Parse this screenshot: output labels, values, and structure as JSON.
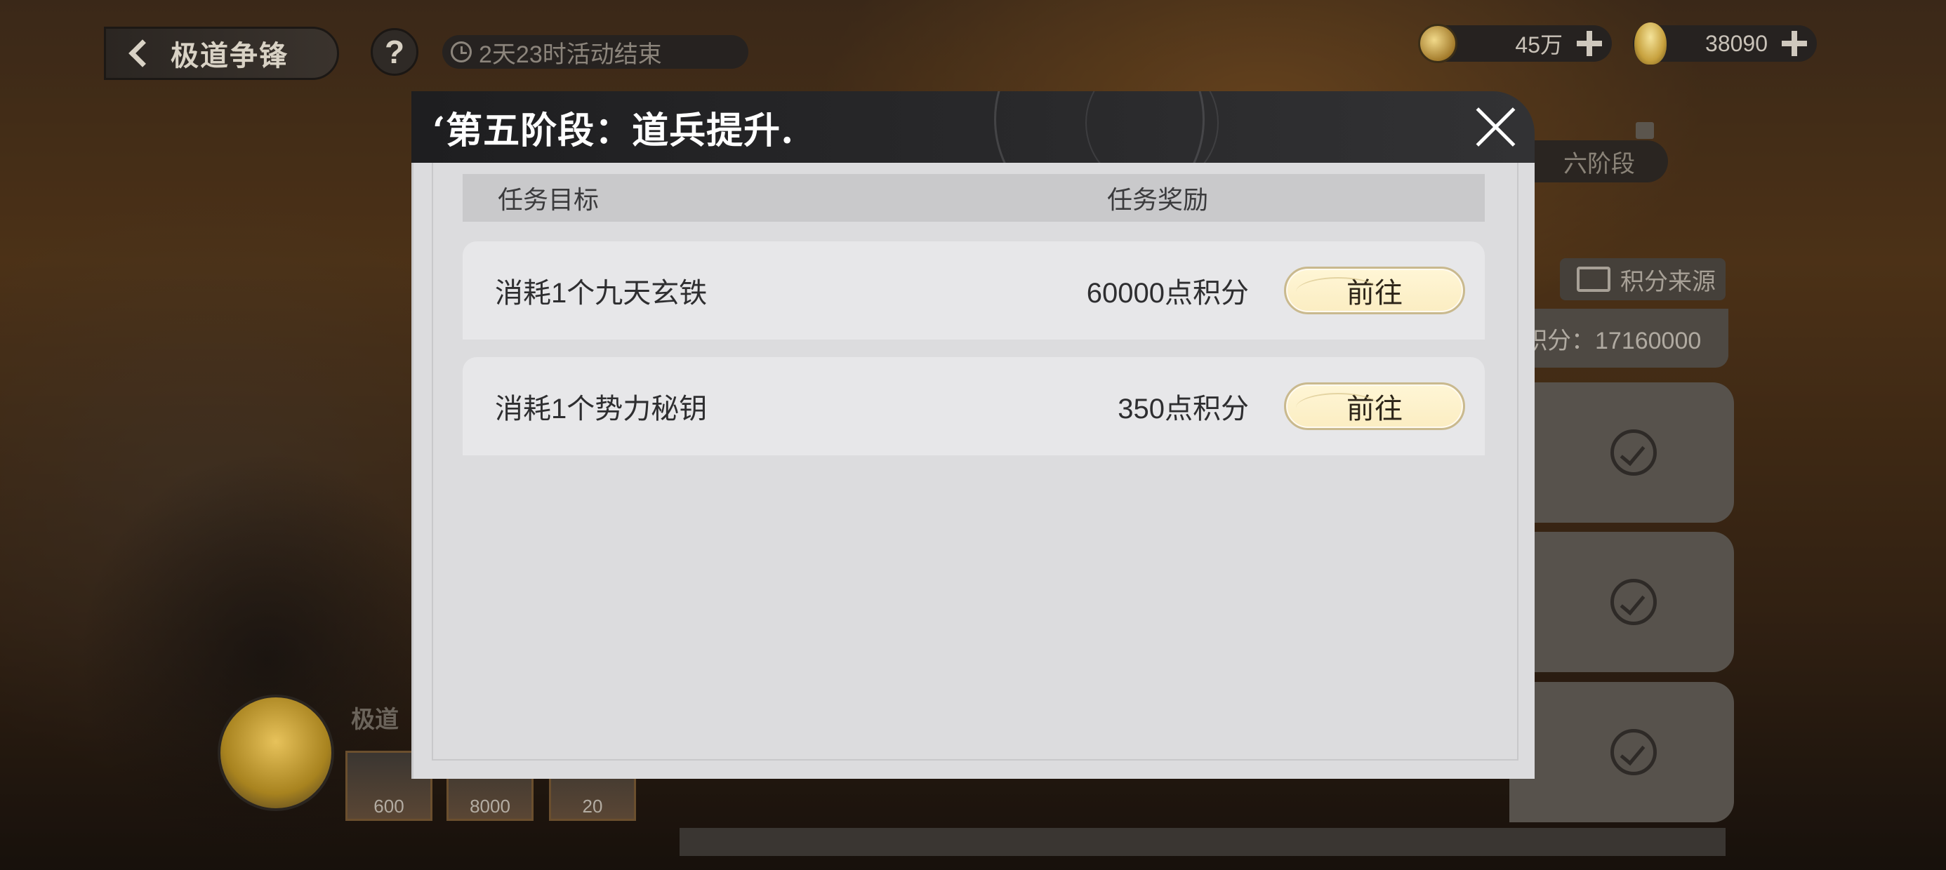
{
  "topbar": {
    "back_label": "极道争锋",
    "help_label": "?",
    "timer_text": "2天23时活动结束",
    "currencies": [
      {
        "icon": "coin-icon",
        "amount": "45万"
      },
      {
        "icon": "gourd-icon",
        "amount": "38090"
      }
    ]
  },
  "background": {
    "stage_tab": "六阶段",
    "source_button": "积分来源",
    "score_text": "积分：17160000",
    "avatar_name": "极道",
    "reward_values": [
      "600",
      "8000",
      "20"
    ]
  },
  "modal": {
    "title": "‘第五阶段：道兵提升.",
    "columns": {
      "goal": "任务目标",
      "reward": "任务奖励"
    },
    "tasks": [
      {
        "name": "消耗1个九天玄铁",
        "reward": "60000点积分",
        "action": "前往"
      },
      {
        "name": "消耗1个势力秘钥",
        "reward": "350点积分",
        "action": "前往"
      }
    ]
  },
  "colors": {
    "modal_header": "#1e1e20",
    "modal_body": "#dcdcde",
    "row_bg": "#e7e7e9",
    "button_fill": "#fbedc2",
    "button_border": "#c9b98e"
  }
}
